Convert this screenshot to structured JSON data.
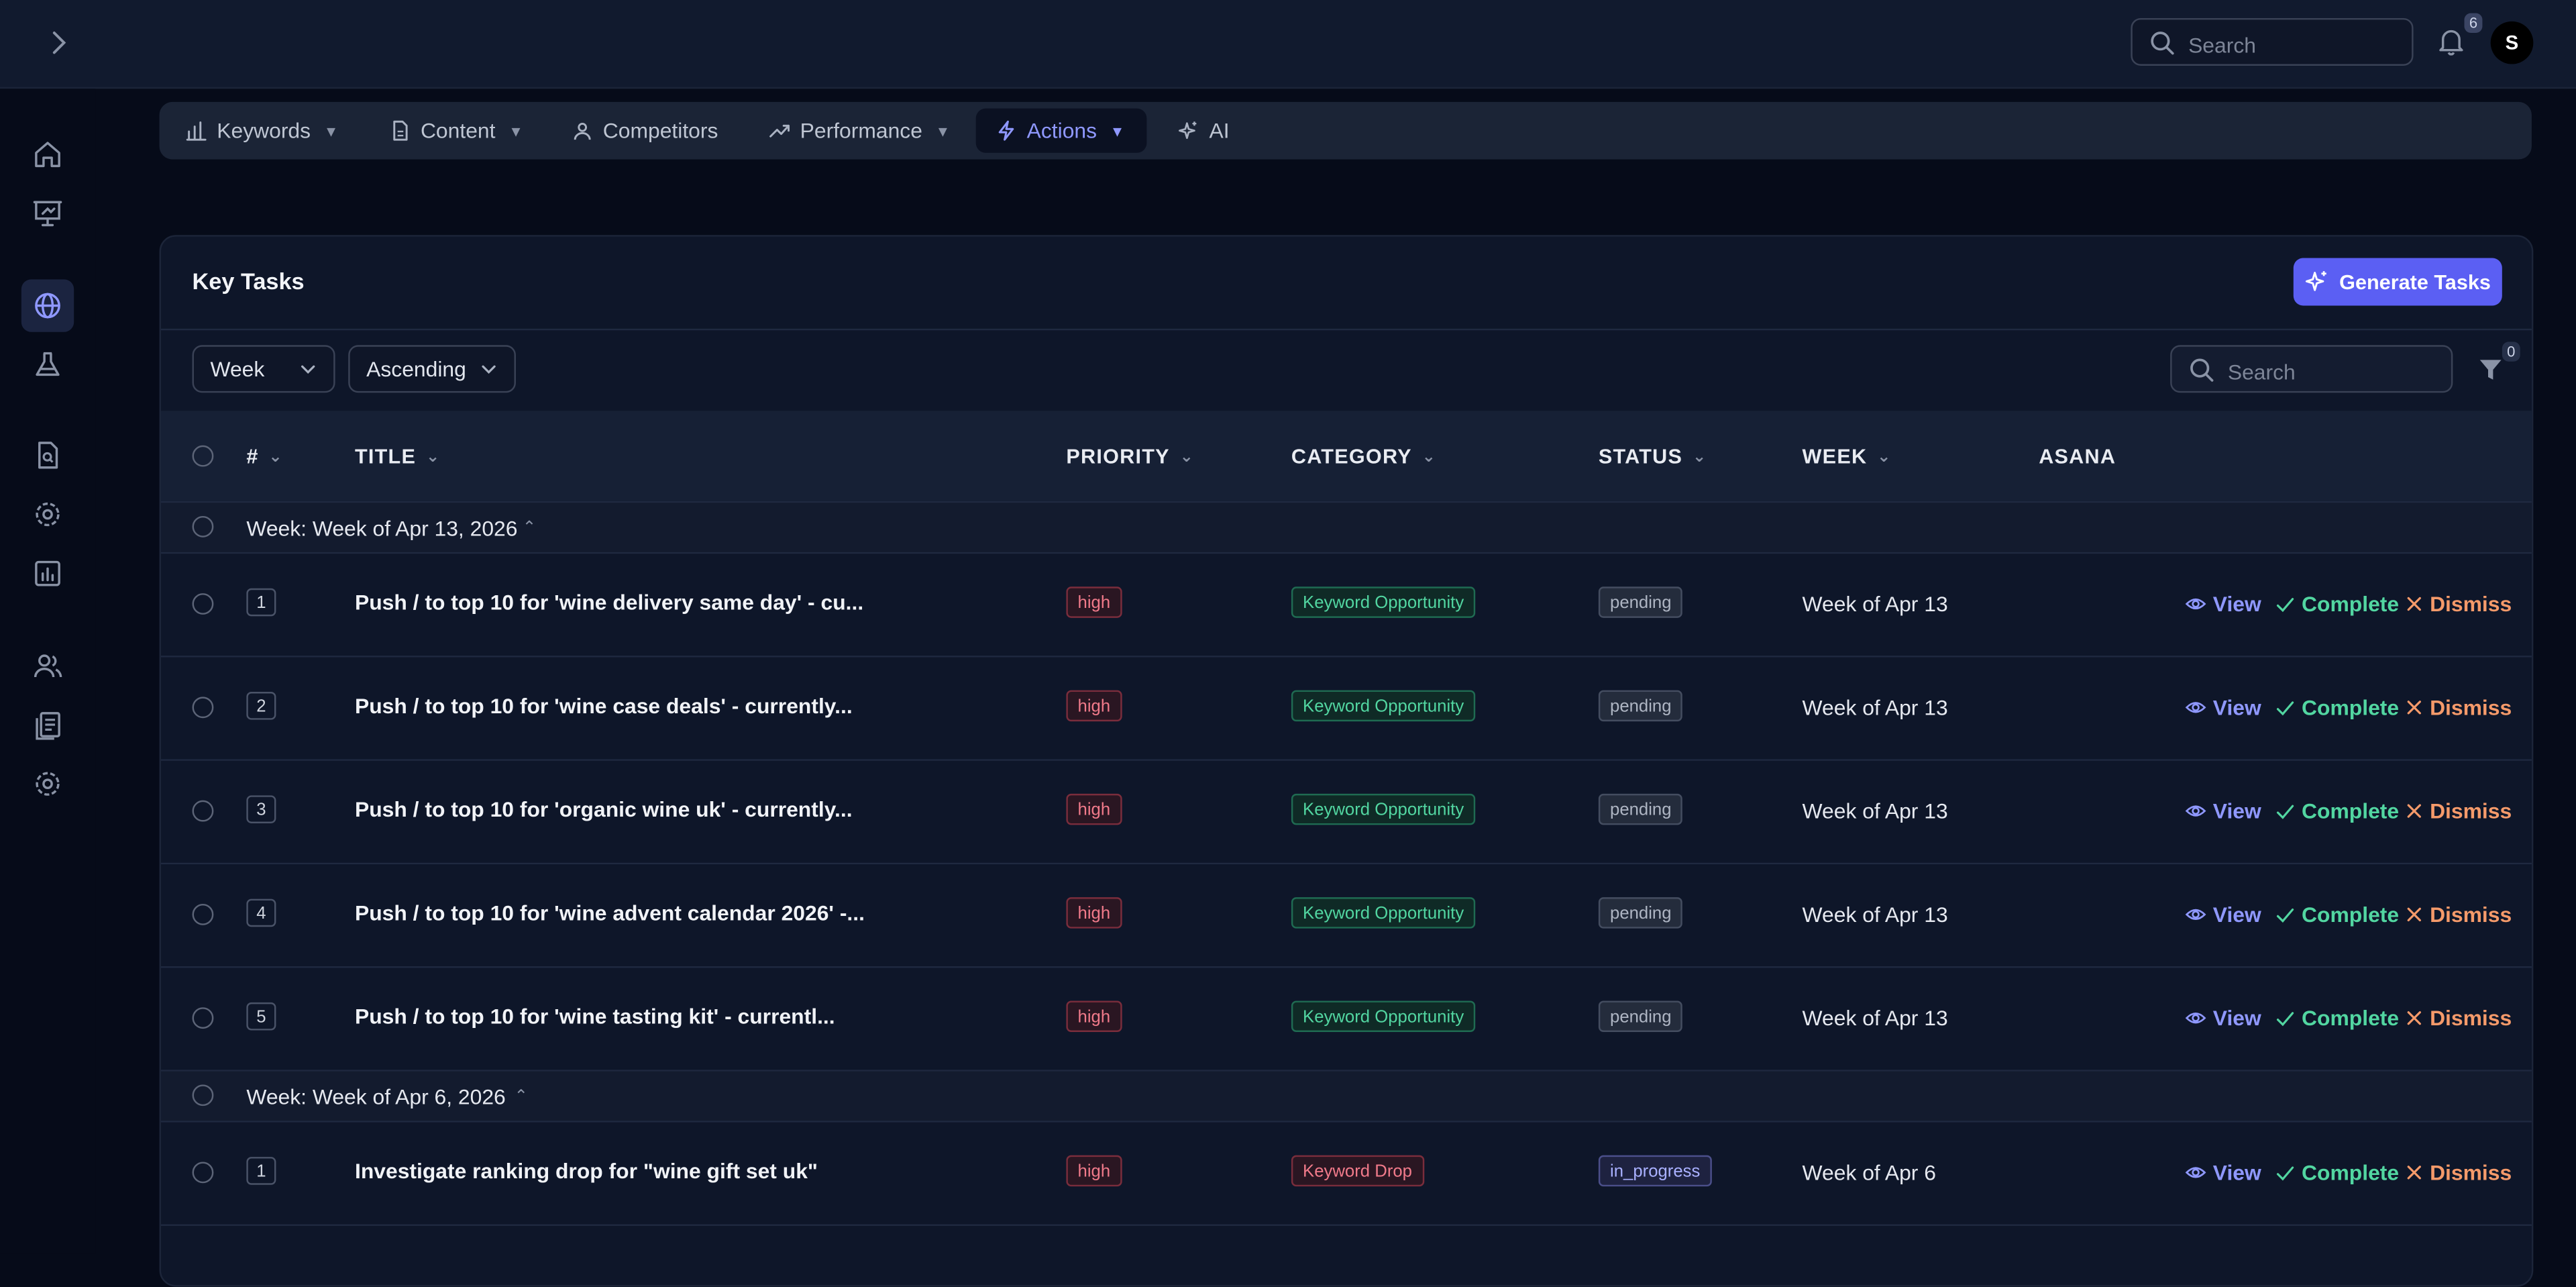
{
  "topbar": {
    "search_placeholder": "Search",
    "notification_count": "6",
    "avatar_initial": "S"
  },
  "nav": {
    "tabs": [
      {
        "label": "Keywords",
        "icon": "bar-chart-icon",
        "dropdown": true
      },
      {
        "label": "Content",
        "icon": "document-icon",
        "dropdown": true
      },
      {
        "label": "Competitors",
        "icon": "users-icon",
        "dropdown": false
      },
      {
        "label": "Performance",
        "icon": "trend-up-icon",
        "dropdown": true
      },
      {
        "label": "Actions",
        "icon": "lightning-icon",
        "dropdown": true,
        "active": true
      },
      {
        "label": "AI",
        "icon": "sparkles-icon",
        "dropdown": false
      }
    ]
  },
  "card": {
    "title": "Key Tasks",
    "generate_label": "Generate Tasks",
    "group_by": "Week",
    "sort_order": "Ascending",
    "search_placeholder": "Search",
    "filter_count": "0"
  },
  "table": {
    "columns": [
      "#",
      "TITLE",
      "PRIORITY",
      "CATEGORY",
      "STATUS",
      "WEEK",
      "ASANA"
    ],
    "groups": [
      {
        "label": "Week: Week of Apr 13, 2026",
        "rows": [
          {
            "num": "1",
            "title": "Push / to top 10 for 'wine delivery same day' - cu...",
            "priority": "high",
            "category": "Keyword Opportunity",
            "status": "pending",
            "week": "Week of Apr 13"
          },
          {
            "num": "2",
            "title": "Push / to top 10 for 'wine case deals' - currently...",
            "priority": "high",
            "category": "Keyword Opportunity",
            "status": "pending",
            "week": "Week of Apr 13"
          },
          {
            "num": "3",
            "title": "Push / to top 10 for 'organic wine uk' - currently...",
            "priority": "high",
            "category": "Keyword Opportunity",
            "status": "pending",
            "week": "Week of Apr 13"
          },
          {
            "num": "4",
            "title": "Push / to top 10 for 'wine advent calendar 2026' -...",
            "priority": "high",
            "category": "Keyword Opportunity",
            "status": "pending",
            "week": "Week of Apr 13"
          },
          {
            "num": "5",
            "title": "Push / to top 10 for 'wine tasting kit' - currentl...",
            "priority": "high",
            "category": "Keyword Opportunity",
            "status": "pending",
            "week": "Week of Apr 13"
          }
        ]
      },
      {
        "label": "Week: Week of Apr 6, 2026",
        "rows": [
          {
            "num": "1",
            "title": "Investigate ranking drop for \"wine gift set uk\"",
            "priority": "high",
            "category": "Keyword Drop",
            "status": "in_progress",
            "week": "Week of Apr 6"
          }
        ]
      }
    ],
    "actions": {
      "view": "View",
      "complete": "Complete",
      "dismiss": "Dismiss"
    }
  },
  "colors": {
    "accent": "#5b5ff3",
    "success": "#52d6a1",
    "danger": "#f07a8a",
    "warning": "#f59a6a"
  }
}
